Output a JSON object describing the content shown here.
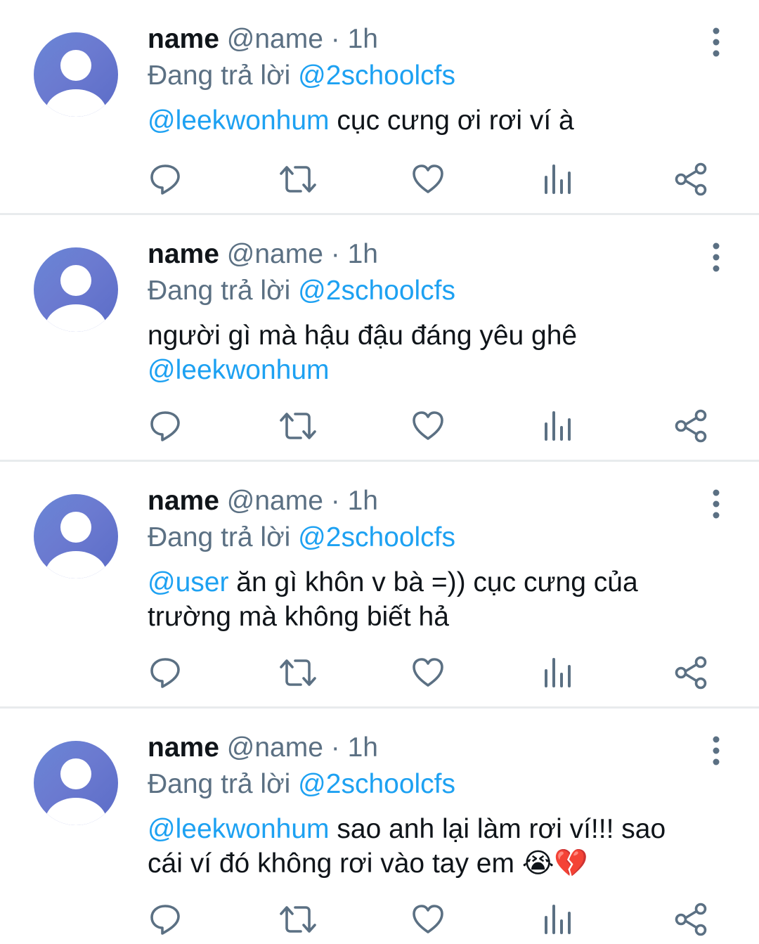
{
  "tweets": [
    {
      "name": "name",
      "handle": "@name",
      "separator": "·",
      "time": "1h",
      "reply_prefix": "Đang trả lời",
      "reply_to": "@2schoolcfs",
      "body": [
        {
          "text": "@leekwonhum",
          "mention": true
        },
        {
          "text": " cục cưng ơi rơi ví à",
          "mention": false
        }
      ]
    },
    {
      "name": "name",
      "handle": "@name",
      "separator": "·",
      "time": "1h",
      "reply_prefix": "Đang trả lời",
      "reply_to": "@2schoolcfs",
      "body": [
        {
          "text": "người gì mà hậu đậu đáng yêu ghê ",
          "mention": false
        },
        {
          "text": "@leekwonhum",
          "mention": true
        }
      ]
    },
    {
      "name": "name",
      "handle": "@name",
      "separator": "·",
      "time": "1h",
      "reply_prefix": "Đang trả lời",
      "reply_to": "@2schoolcfs",
      "body": [
        {
          "text": "@user",
          "mention": true
        },
        {
          "text": " ăn gì khôn v bà =)) cục cưng của trường mà không biết hả",
          "mention": false
        }
      ]
    },
    {
      "name": "name",
      "handle": "@name",
      "separator": "·",
      "time": "1h",
      "reply_prefix": "Đang trả lời",
      "reply_to": "@2schoolcfs",
      "body": [
        {
          "text": "@leekwonhum",
          "mention": true
        },
        {
          "text": " sao anh lại làm rơi ví!!! sao cái ví đó không rơi vào tay em 😭💔",
          "mention": false
        }
      ]
    }
  ],
  "icons": [
    "reply-icon",
    "retweet-icon",
    "like-icon",
    "analytics-icon",
    "share-icon",
    "more-options-icon"
  ],
  "colors": {
    "mention": "#1da1f2",
    "secondary_text": "#5b7083",
    "icon": "#5b7083",
    "divider": "#e8ebed",
    "avatar": "#6b7ad0"
  }
}
